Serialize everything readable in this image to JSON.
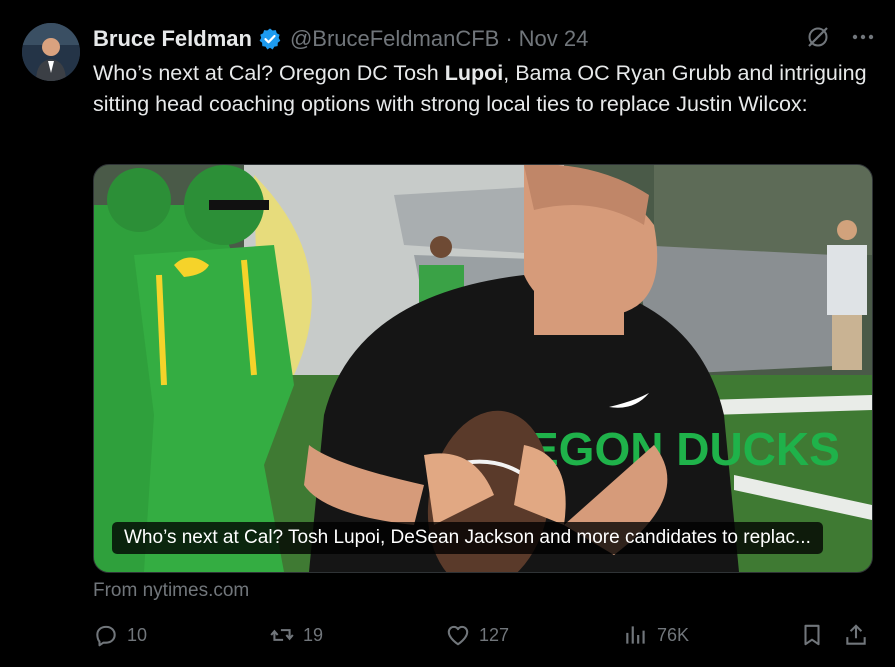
{
  "tweet": {
    "author_name": "Bruce Feldman",
    "handle": "@BruceFeldmanCFB",
    "separator": "·",
    "date": "Nov 24",
    "text_parts": {
      "p1": "Who’s next at Cal? Oregon DC Tosh ",
      "p2": "Lupoi",
      "p3": ", Bama OC Ryan Grubb and intriguing sitting head coaching options with strong local ties to replace Justin Wilcox:"
    },
    "media_caption": "Who’s next at Cal? Tosh Lupoi, DeSean Jackson and more candidates to replac...",
    "shirt_text": "OREGON DUCKS",
    "source": "From nytimes.com"
  },
  "actions": {
    "replies": "10",
    "reposts": "19",
    "likes": "127",
    "views": "76K"
  },
  "icons": {
    "verified": "verified-badge-icon",
    "grok": "grok-icon",
    "more": "more-icon",
    "reply": "reply-icon",
    "repost": "repost-icon",
    "like": "heart-icon",
    "views": "views-icon",
    "bookmark": "bookmark-icon",
    "share": "share-icon"
  },
  "colors": {
    "background": "#000000",
    "text": "#e7e9ea",
    "muted": "#71767b",
    "verified": "#1d9bf0",
    "oregon_green": "#2e9a3c",
    "oregon_yellow": "#f5d32a"
  }
}
